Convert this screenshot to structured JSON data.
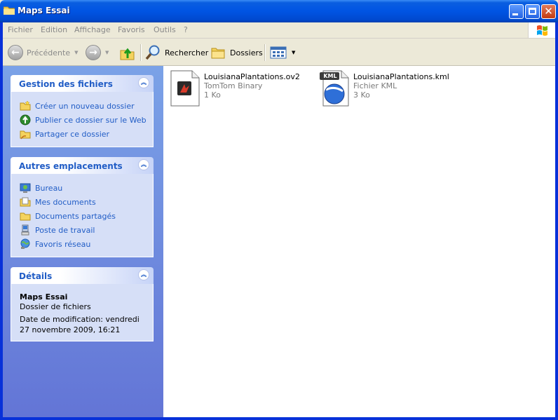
{
  "window": {
    "title": "Maps Essai",
    "controls": {
      "minimize": "minimize-icon",
      "maximize": "maximize-icon",
      "close": "close-icon"
    }
  },
  "menu": {
    "items": [
      "Fichier",
      "Edition",
      "Affichage",
      "Favoris",
      "Outils",
      "?"
    ]
  },
  "toolbar": {
    "back_label": "Précédente",
    "search_label": "Rechercher",
    "folders_label": "Dossiers"
  },
  "panels": {
    "file_tasks": {
      "title": "Gestion des fichiers",
      "items": [
        {
          "label": "Créer un nouveau dossier",
          "icon": "new-folder-icon"
        },
        {
          "label": "Publier ce dossier sur le Web",
          "icon": "publish-web-icon"
        },
        {
          "label": "Partager ce dossier",
          "icon": "share-folder-icon"
        }
      ]
    },
    "other_places": {
      "title": "Autres emplacements",
      "items": [
        {
          "label": "Bureau",
          "icon": "desktop-icon"
        },
        {
          "label": "Mes documents",
          "icon": "my-documents-icon"
        },
        {
          "label": "Documents partagés",
          "icon": "shared-documents-icon"
        },
        {
          "label": "Poste de travail",
          "icon": "my-computer-icon"
        },
        {
          "label": "Favoris réseau",
          "icon": "network-places-icon"
        }
      ]
    },
    "details": {
      "title": "Détails",
      "name": "Maps Essai",
      "type": "Dossier de fichiers",
      "modified": "Date de modification: vendredi 27 novembre 2009, 16:21"
    }
  },
  "files": [
    {
      "name": "LouisianaPlantations.ov2",
      "type": "TomTom Binary",
      "size": "1 Ko",
      "icon": "ov2-file-icon"
    },
    {
      "name": "LouisianaPlantations.kml",
      "type": "Fichier KML",
      "size": "3 Ko",
      "icon": "kml-file-icon",
      "badge": "KML"
    }
  ],
  "colors": {
    "titlebar": "#0054e3",
    "link": "#215dc6",
    "panel_body": "#d6dff7",
    "pane_gradient_top": "#7ba2e7",
    "pane_gradient_bottom": "#6375d6"
  }
}
